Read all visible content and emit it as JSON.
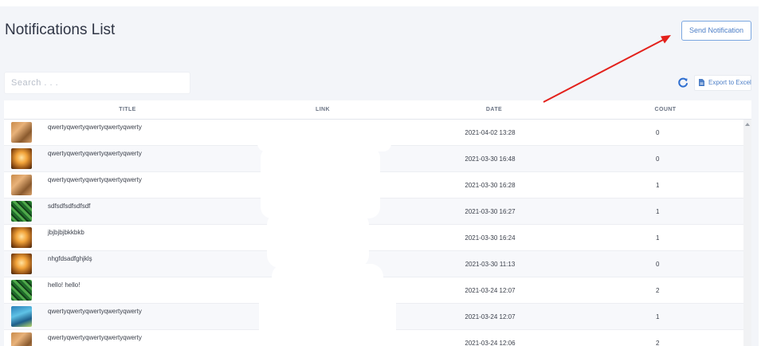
{
  "header": {
    "title": "Notifications List",
    "send_button": "Send Notification"
  },
  "toolbar": {
    "search_placeholder": "Search . . .",
    "export_label": "Export to Excel"
  },
  "table": {
    "columns": [
      "TITLE",
      "LINK",
      "DATE",
      "COUNT"
    ],
    "rows": [
      {
        "title": "qwertyqwertyqwertyqwertyqwerty",
        "date": "2021-04-02 13:28",
        "count": "0",
        "thumb": "brown-image-icon"
      },
      {
        "title": "qwertyqwertyqwertyqwertyqwerty",
        "date": "2021-03-30 16:48",
        "count": "0",
        "thumb": "orange-image-icon"
      },
      {
        "title": "qwertyqwertyqwertyqwertyqwerty",
        "date": "2021-03-30 16:28",
        "count": "1",
        "thumb": "brown-image-icon"
      },
      {
        "title": "sdfsdfsdfsdfsdf",
        "date": "2021-03-30 16:27",
        "count": "1",
        "thumb": "green-image-icon"
      },
      {
        "title": "jbjbjbjbkkbkb",
        "date": "2021-03-30 16:24",
        "count": "1",
        "thumb": "orange-image-icon"
      },
      {
        "title": "nhgfdsadfghjklş",
        "date": "2021-03-30 11:13",
        "count": "0",
        "thumb": "orange-image-icon"
      },
      {
        "title": "hello! hello!",
        "date": "2021-03-24 12:07",
        "count": "2",
        "thumb": "green-image-icon"
      },
      {
        "title": "qwertyqwertyqwertyqwertyqwerty",
        "date": "2021-03-24 12:07",
        "count": "1",
        "thumb": "blue-image-icon"
      },
      {
        "title": "qwertyqwertyqwertyqwertyqwerty",
        "date": "2021-03-24 12:06",
        "count": "2",
        "thumb": "brown-image-icon"
      }
    ]
  },
  "colors": {
    "accent": "#4d7fc7",
    "annotation_arrow": "#e3211c",
    "background": "#f3f5f9"
  }
}
